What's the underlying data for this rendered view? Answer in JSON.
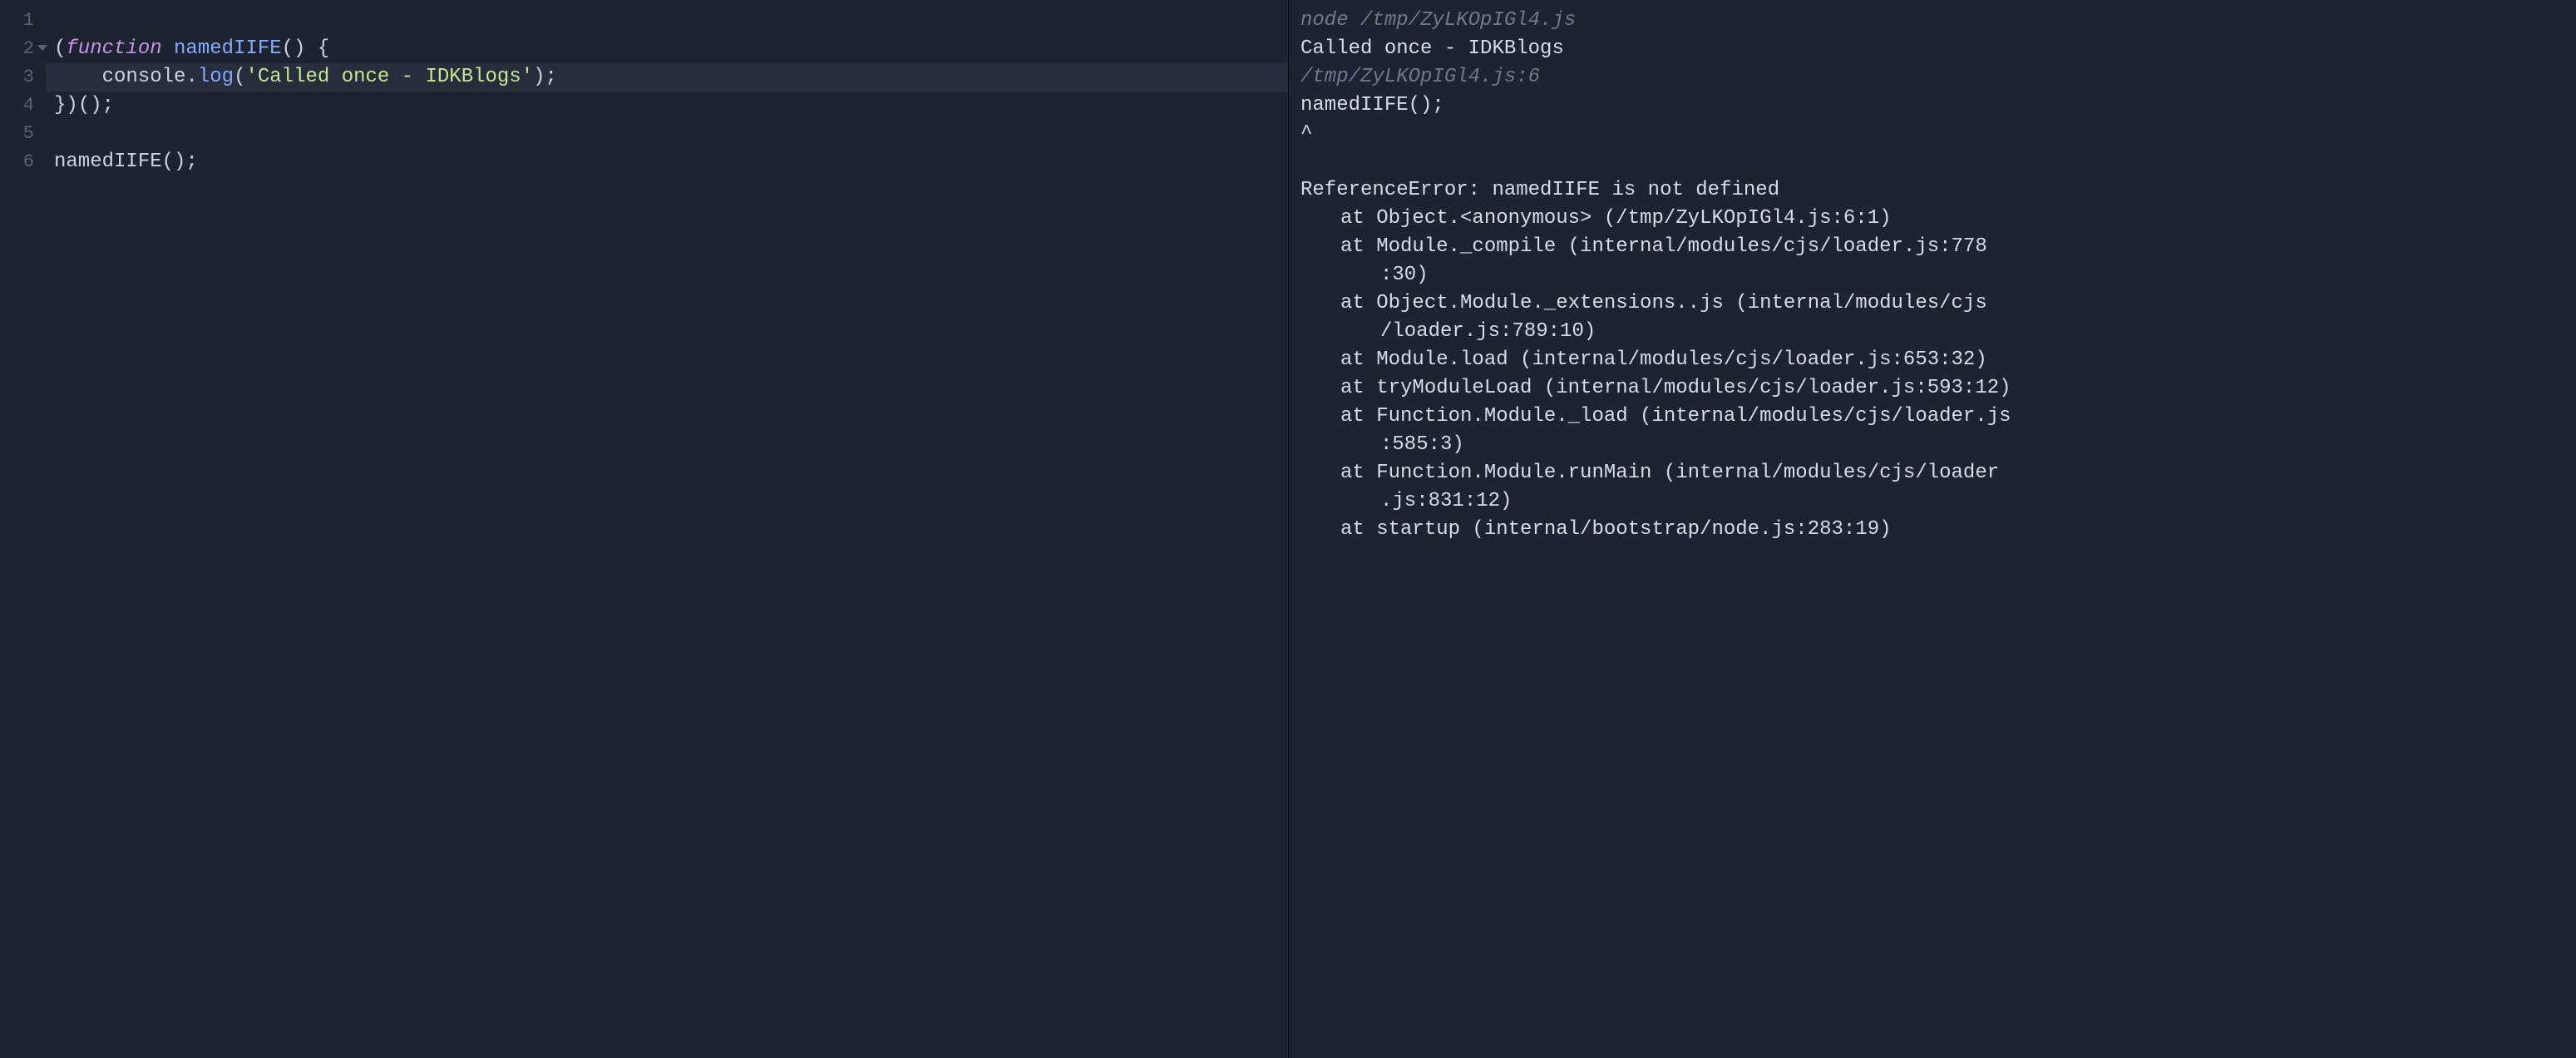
{
  "editor": {
    "gutter": [
      "1",
      "2",
      "3",
      "4",
      "5",
      "6"
    ],
    "foldLine": 2,
    "highlightLine": 3,
    "lines": [
      [
        {
          "t": "",
          "c": "tok-punct"
        }
      ],
      [
        {
          "t": "(",
          "c": "tok-paren"
        },
        {
          "t": "function",
          "c": "tok-keyword"
        },
        {
          "t": " ",
          "c": "tok-punct"
        },
        {
          "t": "namedIIFE",
          "c": "tok-funcname"
        },
        {
          "t": "()",
          "c": "tok-paren"
        },
        {
          "t": " ",
          "c": "tok-punct"
        },
        {
          "t": "{",
          "c": "tok-paren"
        }
      ],
      [
        {
          "t": "    ",
          "c": "tok-punct"
        },
        {
          "t": "console",
          "c": "tok-ident"
        },
        {
          "t": ".",
          "c": "tok-punct"
        },
        {
          "t": "log",
          "c": "tok-method"
        },
        {
          "t": "(",
          "c": "tok-paren"
        },
        {
          "t": "'Called once - IDKBlogs'",
          "c": "tok-string"
        },
        {
          "t": ")",
          "c": "tok-paren"
        },
        {
          "t": ";",
          "c": "tok-punct"
        }
      ],
      [
        {
          "t": "}",
          "c": "tok-paren"
        },
        {
          "t": ")",
          "c": "tok-paren"
        },
        {
          "t": "()",
          "c": "tok-paren"
        },
        {
          "t": ";",
          "c": "tok-punct"
        }
      ],
      [
        {
          "t": "",
          "c": "tok-punct"
        }
      ],
      [
        {
          "t": "namedIIFE",
          "c": "tok-ident"
        },
        {
          "t": "()",
          "c": "tok-paren"
        },
        {
          "t": ";",
          "c": "tok-punct"
        }
      ]
    ]
  },
  "output": {
    "lines": [
      {
        "text": "node /tmp/ZyLKOpIGl4.js",
        "cls": "out-dim"
      },
      {
        "text": "Called once - IDKBlogs",
        "cls": ""
      },
      {
        "text": "/tmp/ZyLKOpIGl4.js:6",
        "cls": "out-dim"
      },
      {
        "text": "namedIIFE();",
        "cls": ""
      },
      {
        "text": "^",
        "cls": ""
      },
      {
        "text": " ",
        "cls": ""
      },
      {
        "text": "ReferenceError: namedIIFE is not defined",
        "cls": ""
      },
      {
        "text": "at Object.<anonymous> (/tmp/ZyLKOpIGl4.js:6:1)",
        "cls": "out-indent"
      },
      {
        "text": "at Module._compile (internal/modules/cjs/loader.js:778",
        "cls": "out-indent"
      },
      {
        "text": ":30)",
        "cls": "out-wrap"
      },
      {
        "text": "at Object.Module._extensions..js (internal/modules/cjs",
        "cls": "out-indent"
      },
      {
        "text": "/loader.js:789:10)",
        "cls": "out-wrap"
      },
      {
        "text": "at Module.load (internal/modules/cjs/loader.js:653:32)",
        "cls": "out-indent"
      },
      {
        "text": "at tryModuleLoad (internal/modules/cjs/loader.js:593:12)",
        "cls": "out-indent"
      },
      {
        "text": "at Function.Module._load (internal/modules/cjs/loader.js",
        "cls": "out-indent"
      },
      {
        "text": ":585:3)",
        "cls": "out-wrap"
      },
      {
        "text": "at Function.Module.runMain (internal/modules/cjs/loader",
        "cls": "out-indent"
      },
      {
        "text": ".js:831:12)",
        "cls": "out-wrap"
      },
      {
        "text": "at startup (internal/bootstrap/node.js:283:19)",
        "cls": "out-indent"
      }
    ]
  }
}
